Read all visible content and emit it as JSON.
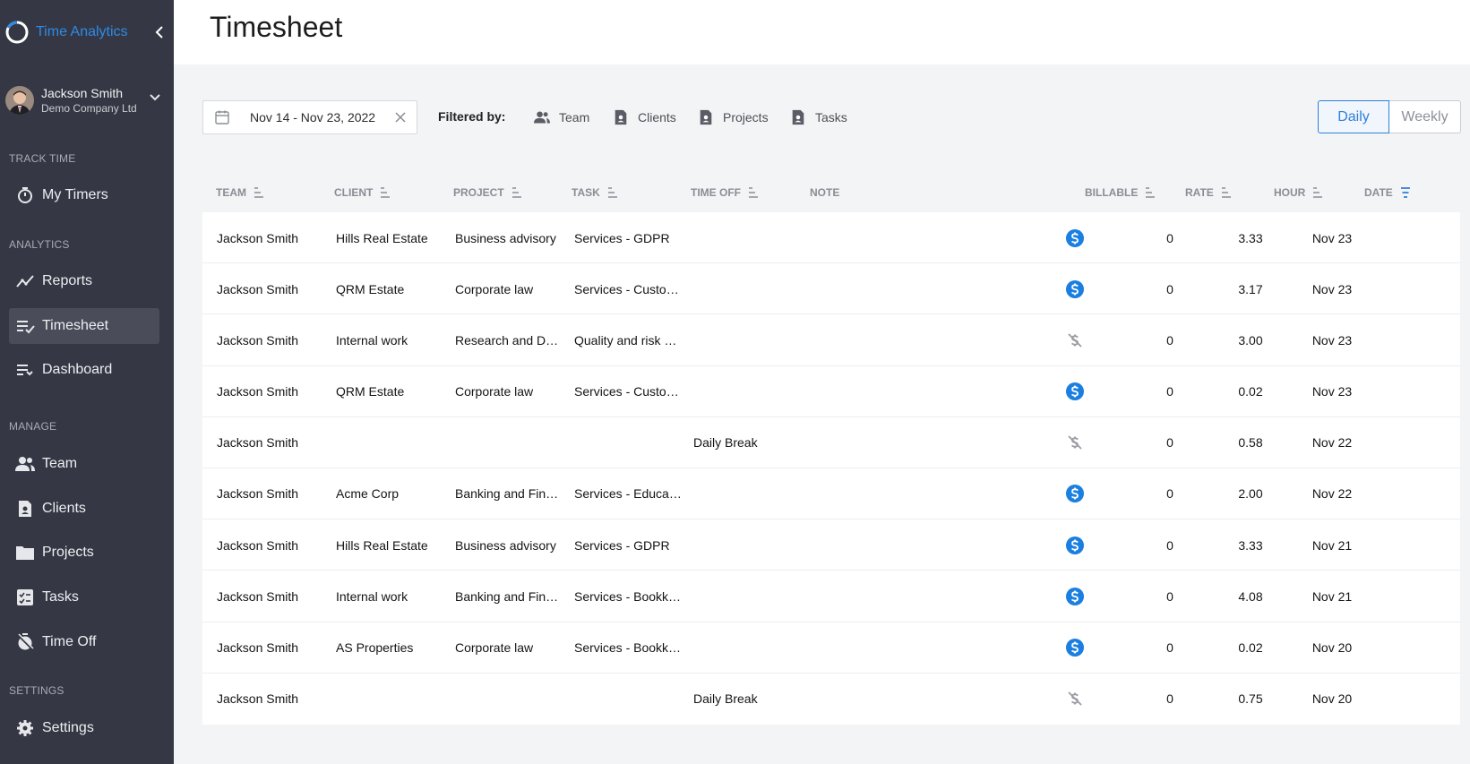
{
  "app": {
    "name": "Time Analytics"
  },
  "user": {
    "name": "Jackson Smith",
    "company": "Demo Company Ltd"
  },
  "sidebar": {
    "sections": [
      {
        "label": "TRACK TIME"
      },
      {
        "label": "ANALYTICS"
      },
      {
        "label": "MANAGE"
      },
      {
        "label": "SETTINGS"
      }
    ],
    "items": [
      {
        "label": "My Timers",
        "icon": "stopwatch-icon"
      },
      {
        "label": "Reports",
        "icon": "trend-line-icon"
      },
      {
        "label": "Timesheet",
        "icon": "list-check-icon",
        "active": true
      },
      {
        "label": "Dashboard",
        "icon": "list-arrow-icon"
      },
      {
        "label": "Team",
        "icon": "people-icon"
      },
      {
        "label": "Clients",
        "icon": "client-doc-icon"
      },
      {
        "label": "Projects",
        "icon": "folder-icon"
      },
      {
        "label": "Tasks",
        "icon": "task-list-icon"
      },
      {
        "label": "Time Off",
        "icon": "time-off-icon"
      },
      {
        "label": "Settings",
        "icon": "gear-icon"
      }
    ]
  },
  "header": {
    "title": "Timesheet"
  },
  "filters": {
    "date_range": "Nov 14 - Nov 23, 2022",
    "filtered_by_label": "Filtered by:",
    "chips": [
      "Team",
      "Clients",
      "Projects",
      "Tasks"
    ]
  },
  "view_toggle": {
    "daily": "Daily",
    "weekly": "Weekly",
    "selected": "Daily"
  },
  "colors": {
    "accent": "#2f7fd8",
    "billable": "#1a7fe0",
    "sidebar": "#353844"
  },
  "table": {
    "columns": [
      "TEAM",
      "CLIENT",
      "PROJECT",
      "TASK",
      "TIME OFF",
      "NOTE",
      "BILLABLE",
      "RATE",
      "HOUR",
      "DATE"
    ],
    "rows": [
      {
        "team": "Jackson Smith",
        "client": "Hills Real Estate",
        "project": "Business advisory",
        "task": "Services - GDPR",
        "time_off": "",
        "note": "",
        "billable": true,
        "rate": "0",
        "hour": "3.33",
        "date": "Nov 23"
      },
      {
        "team": "Jackson Smith",
        "client": "QRM Estate",
        "project": "Corporate law",
        "task": "Services - Custo…",
        "time_off": "",
        "note": "",
        "billable": true,
        "rate": "0",
        "hour": "3.17",
        "date": "Nov 23"
      },
      {
        "team": "Jackson Smith",
        "client": "Internal work",
        "project": "Research and De…",
        "task": "Quality and risk …",
        "time_off": "",
        "note": "",
        "billable": false,
        "rate": "0",
        "hour": "3.00",
        "date": "Nov 23"
      },
      {
        "team": "Jackson Smith",
        "client": "QRM Estate",
        "project": "Corporate law",
        "task": "Services - Custo…",
        "time_off": "",
        "note": "",
        "billable": true,
        "rate": "0",
        "hour": "0.02",
        "date": "Nov 23"
      },
      {
        "team": "Jackson Smith",
        "client": "",
        "project": "",
        "task": "",
        "time_off": "Daily Break",
        "note": "",
        "billable": false,
        "rate": "0",
        "hour": "0.58",
        "date": "Nov 22"
      },
      {
        "team": "Jackson Smith",
        "client": "Acme Corp",
        "project": "Banking and Fin…",
        "task": "Services - Educa…",
        "time_off": "",
        "note": "",
        "billable": true,
        "rate": "0",
        "hour": "2.00",
        "date": "Nov 22"
      },
      {
        "team": "Jackson Smith",
        "client": "Hills Real Estate",
        "project": "Business advisory",
        "task": "Services - GDPR",
        "time_off": "",
        "note": "",
        "billable": true,
        "rate": "0",
        "hour": "3.33",
        "date": "Nov 21"
      },
      {
        "team": "Jackson Smith",
        "client": "Internal work",
        "project": "Banking and Fin…",
        "task": "Services - Bookk…",
        "time_off": "",
        "note": "",
        "billable": true,
        "rate": "0",
        "hour": "4.08",
        "date": "Nov 21"
      },
      {
        "team": "Jackson Smith",
        "client": "AS Properties",
        "project": "Corporate law",
        "task": "Services - Bookk…",
        "time_off": "",
        "note": "",
        "billable": true,
        "rate": "0",
        "hour": "0.02",
        "date": "Nov 20"
      },
      {
        "team": "Jackson Smith",
        "client": "",
        "project": "",
        "task": "",
        "time_off": "Daily Break",
        "note": "",
        "billable": false,
        "rate": "0",
        "hour": "0.75",
        "date": "Nov 20"
      }
    ]
  }
}
